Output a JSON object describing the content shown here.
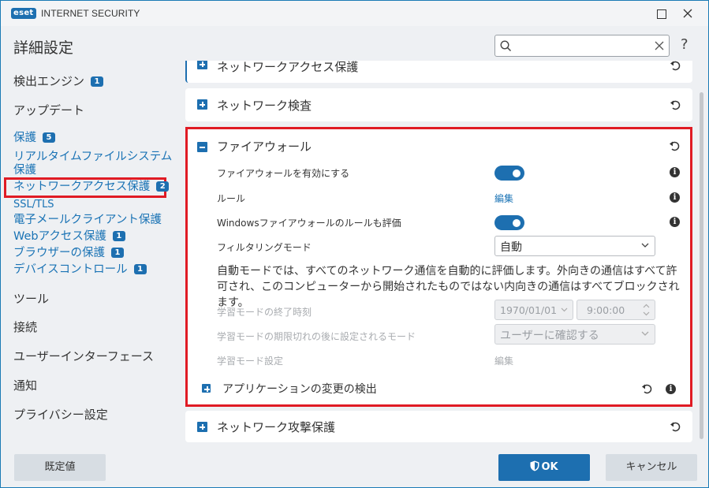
{
  "titlebar": {
    "logo": "eset",
    "app_title": "INTERNET SECURITY"
  },
  "header": {
    "page_title": "詳細設定",
    "search_placeholder": "",
    "help": "?"
  },
  "sidebar": {
    "detection": {
      "label": "検出エンジン",
      "badge": "1"
    },
    "update": {
      "label": "アップデート"
    },
    "protection": {
      "label": "保護",
      "badge": "5"
    },
    "realtime": {
      "label_line1": "リアルタイムファイルシステム",
      "label_line2": "保護"
    },
    "network_access": {
      "label": "ネットワークアクセス保護",
      "badge": "2"
    },
    "ssl": {
      "label": "SSL/TLS"
    },
    "email": {
      "label": "電子メールクライアント保護"
    },
    "web": {
      "label": "Webアクセス保護",
      "badge": "1"
    },
    "browser": {
      "label": "ブラウザーの保護",
      "badge": "1"
    },
    "device": {
      "label": "デバイスコントロール",
      "badge": "1"
    },
    "tools": {
      "label": "ツール"
    },
    "connection": {
      "label": "接続"
    },
    "ui": {
      "label": "ユーザーインターフェース"
    },
    "notifications": {
      "label": "通知"
    },
    "privacy": {
      "label": "プライバシー設定"
    }
  },
  "main": {
    "sections": {
      "network_access": {
        "title": "ネットワークアクセス保護"
      },
      "network_inspection": {
        "title": "ネットワーク検査"
      },
      "firewall": {
        "title": "ファイアウォール"
      },
      "attack": {
        "title": "ネットワーク攻撃保護"
      }
    },
    "firewall": {
      "enable_label": "ファイアウォールを有効にする",
      "enable_on": true,
      "rules_label": "ルール",
      "rules_link": "編集",
      "windows_label": "Windowsファイアウォールのルールも評価",
      "windows_on": true,
      "filter_mode_label": "フィルタリングモード",
      "filter_mode_value": "自動",
      "description": "自動モードでは、すべてのネットワーク通信を自動的に評価します。外向きの通信はすべて許可され、このコンピューターから開始されたものではない内向きの通信はすべてブロックされます。",
      "learn_end_label": "学習モードの終了時刻",
      "learn_end_date": "1970/01/01",
      "learn_end_time": "9:00:00",
      "learn_after_label": "学習モードの期限切れの後に設定されるモード",
      "learn_after_value": "ユーザーに確認する",
      "learn_settings_label": "学習モード設定",
      "learn_settings_link": "編集",
      "app_change_title": "アプリケーションの変更の検出"
    }
  },
  "footer": {
    "default_label": "既定値",
    "ok_label": "OK",
    "cancel_label": "キャンセル"
  },
  "colors": {
    "accent": "#1d6fb0",
    "highlight": "#e01b24",
    "link": "#1a73b5"
  }
}
